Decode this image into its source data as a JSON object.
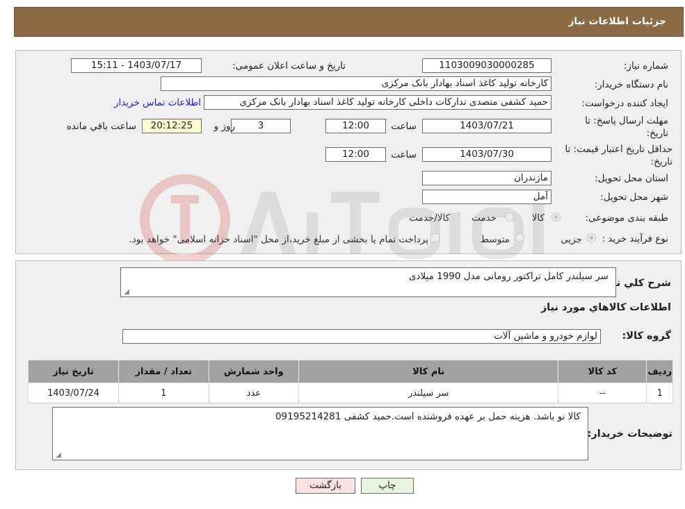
{
  "header": {
    "title": "جزئیات اطلاعات نیاز"
  },
  "form": {
    "need_number": {
      "label": "شماره نیاز:",
      "value": "1103009030000285"
    },
    "announce_datetime": {
      "label": "تاریخ و ساعت اعلان عمومی:",
      "value": "1403/07/17 - 15:11"
    },
    "buyer_org": {
      "label": "نام دستگاه خریدار:",
      "value": "کارخانه تولید کاغذ اسناد بهادار بانک مرکزی"
    },
    "requester": {
      "label": "ایجاد کننده درخواست:",
      "value": "حمید کشفی متصدی تدارکات داخلی کارخانه تولید کاغذ اسناد بهادار بانک مرکزی",
      "contact_link": "اطلاعات تماس خریدار"
    },
    "response_deadline": {
      "label": "مهلت ارسال پاسخ: تا تاریخ:",
      "date": "1403/07/21",
      "time_label": "ساعت",
      "time": "12:00",
      "days": "3",
      "days_label": "روز و",
      "remaining": "20:12:25",
      "remaining_label": "ساعت باقي مانده"
    },
    "price_validity": {
      "label": "حداقل تاریخ اعتبار قیمت: تا تاریخ:",
      "date": "1403/07/30",
      "time_label": "ساعت",
      "time": "12:00"
    },
    "delivery_province": {
      "label": "استان محل تحویل:",
      "value": "مازندران"
    },
    "delivery_city": {
      "label": "شهر محل تحویل:",
      "value": "آمل"
    },
    "category": {
      "label": "طبقه بندی موضوعی:",
      "options": [
        "کالا",
        "خدمت",
        "کالا/خدمت"
      ],
      "selected": "کالا"
    },
    "purchase_process": {
      "label": "نوع فرآیند خرید :",
      "options": [
        "جزیی",
        "متوسط"
      ],
      "note": "پرداخت تمام یا بخشی از مبلغ خرید،از محل \"اسناد خزانه اسلامی\" خواهد بود."
    }
  },
  "details": {
    "summary_label": "شرح کلي نياز:",
    "summary_value": "سر سیلندر کامل تراکتور رومانی مدل 1990 میلادی",
    "items_heading": "اطلاعات کالاهاي مورد نياز",
    "group_label": "گروه کالا:",
    "group_value": "لوازم خودرو و ماشین آلات",
    "table": {
      "headers": [
        "رديف",
        "کد کالا",
        "نام کالا",
        "واحد شمارش",
        "تعداد / مقدار",
        "تاریخ نیاز"
      ],
      "rows": [
        [
          "1",
          "--",
          "سر سیلندر",
          "عدد",
          "1",
          "1403/07/24"
        ]
      ]
    },
    "buyer_notes_label": "توضیحات خریدار:",
    "buyer_notes_value": "کالا نو باشد. هزینه حمل بر عهده فروشنده است.حمید کشفی 09195214281"
  },
  "buttons": {
    "print": "چاپ",
    "back": "بازگشت"
  },
  "colors": {
    "header_bg": "#8b6b46",
    "panel_bg": "#f0f0f0",
    "table_header_bg": "#a2a2a2",
    "remaining_bg": "#fdfbd3",
    "back_button_bg": "#fbe3e3",
    "print_button_bg": "#e6f5e0",
    "link": "#1a1ae6"
  }
}
